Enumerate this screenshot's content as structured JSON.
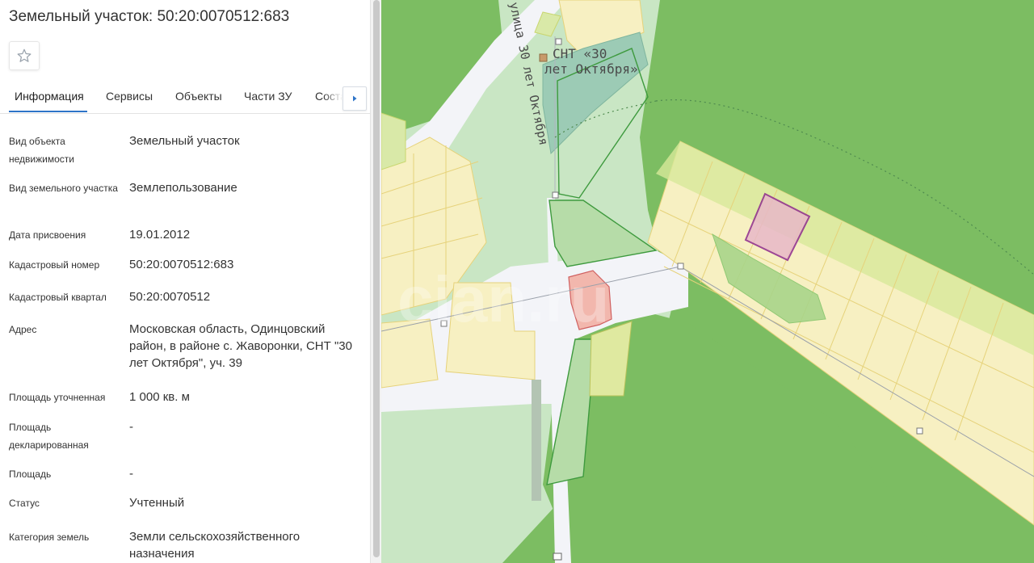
{
  "title": "Земельный участок: 50:20:0070512:683",
  "tabs": [
    "Информация",
    "Сервисы",
    "Объекты",
    "Части ЗУ",
    "Соста"
  ],
  "rows": [
    {
      "label": "Вид объекта недвижимости",
      "value": "Земельный участок"
    },
    {
      "label": "Вид земельного участка",
      "value": "Землепользование"
    },
    {
      "label": "Дата присвоения",
      "value": "19.01.2012"
    },
    {
      "label": "Кадастровый номер",
      "value": "50:20:0070512:683"
    },
    {
      "label": "Кадастровый квартал",
      "value": "50:20:0070512"
    },
    {
      "label": "Адрес",
      "value": "Московская область, Одинцовский район, в районе с. Жаворонки, СНТ \"30 лет Октября\", уч. 39"
    },
    {
      "label": "Площадь уточненная",
      "value": "1 000 кв. м"
    },
    {
      "label": "Площадь декларированная",
      "value": "-"
    },
    {
      "label": "Площадь",
      "value": "-"
    },
    {
      "label": "Статус",
      "value": "Учтенный"
    },
    {
      "label": "Категория земель",
      "value": "Земли сельскохозяйственного назначения"
    }
  ],
  "map": {
    "street_label": "улица 30 лет Октября",
    "snt_label_line1": "СНТ «30",
    "snt_label_line2": "лет Октября»",
    "watermark": "cian.ru"
  },
  "icons": {
    "favorite": "star-icon",
    "tabs_next": "chevron-right-icon"
  },
  "colors": {
    "accent": "#2e74c8",
    "forest": "#7cbd62",
    "parcel": "#f7f0c2",
    "selected_parcel": "#e8b8c8"
  }
}
